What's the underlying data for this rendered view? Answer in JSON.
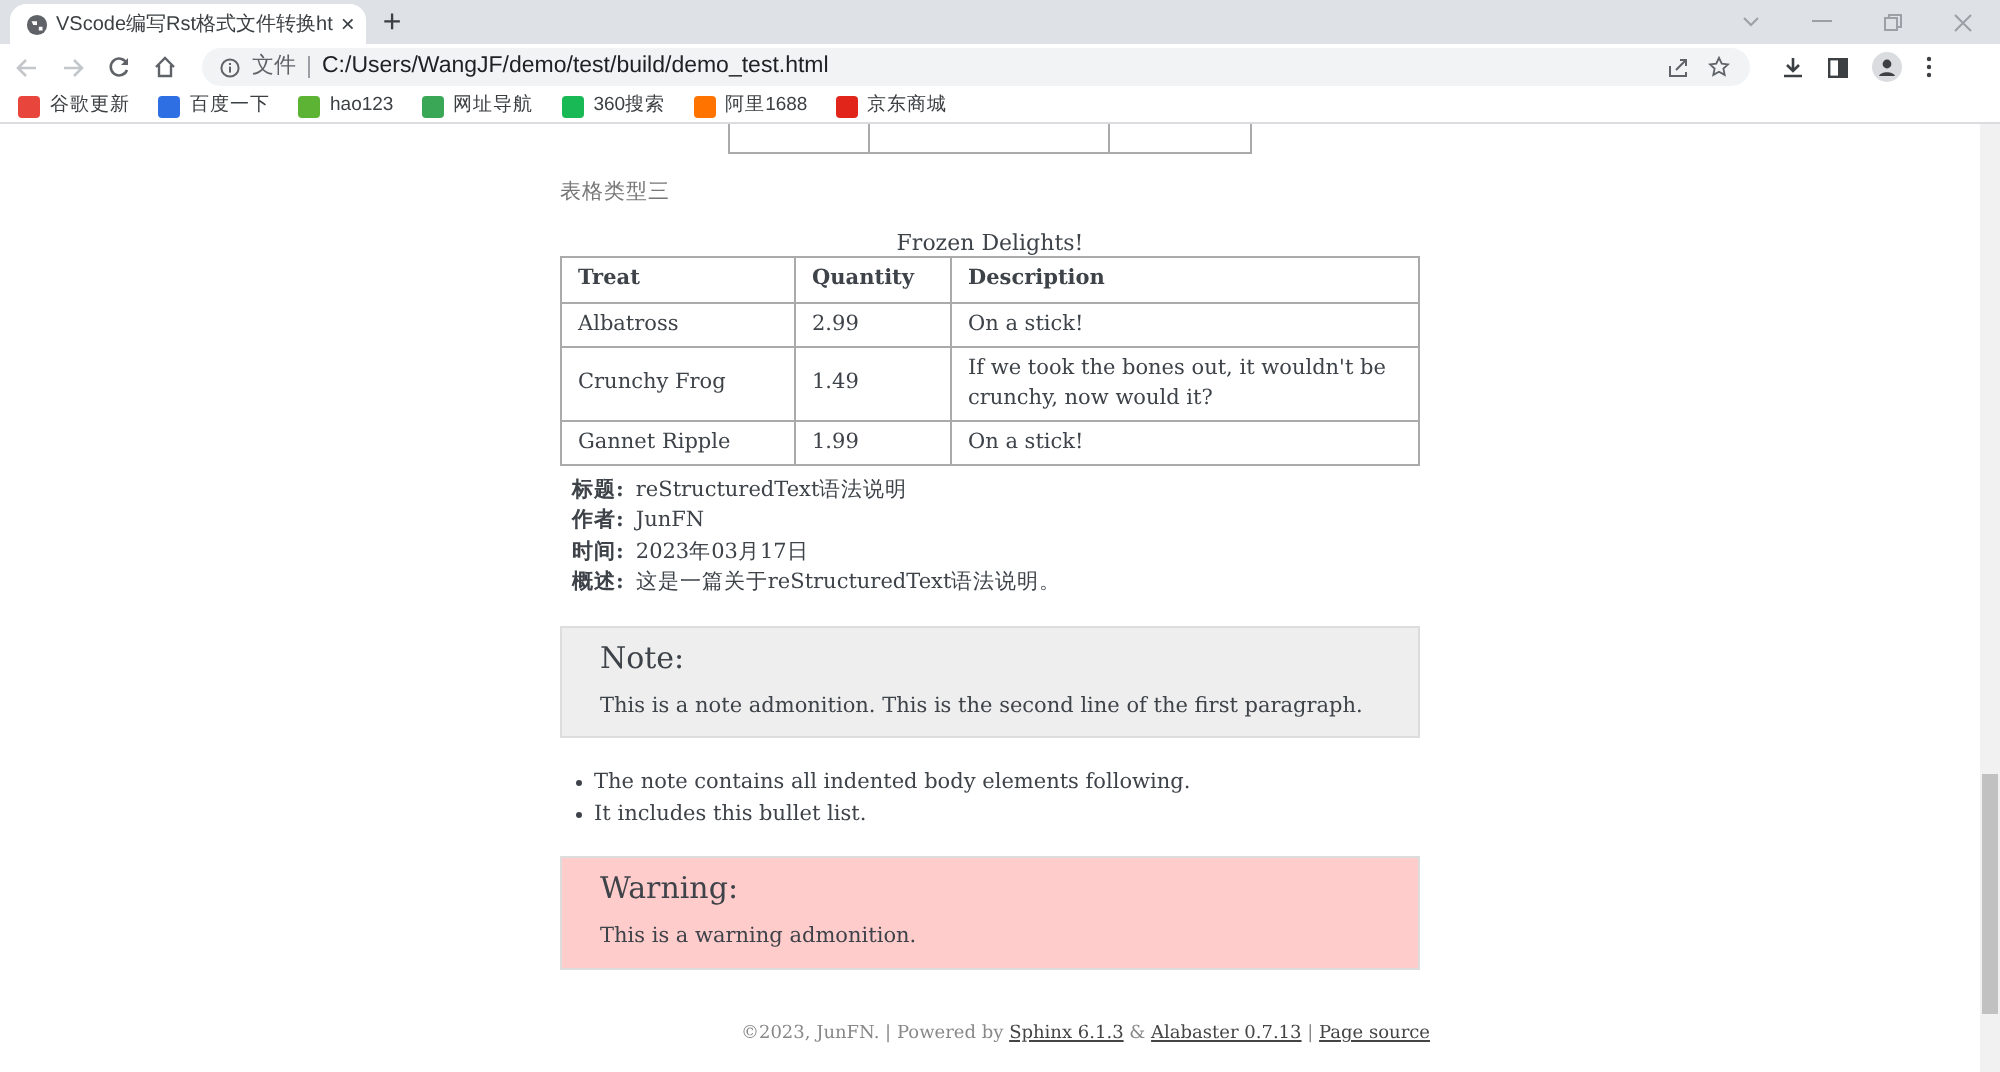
{
  "browser": {
    "tab": {
      "title": "VScode编写Rst格式文件转换ht",
      "close": "×"
    },
    "new_tab": "+",
    "address": {
      "scheme": "文件",
      "url": "C:/Users/WangJF/demo/test/build/demo_test.html"
    },
    "bookmarks": [
      {
        "label": "谷歌更新",
        "color": "#e8453c"
      },
      {
        "label": "百度一下",
        "color": "#2f6fe4"
      },
      {
        "label": "hao123",
        "color": "#5db333"
      },
      {
        "label": "网址导航",
        "color": "#3aa757"
      },
      {
        "label": "360搜索",
        "color": "#19b955"
      },
      {
        "label": "阿里1688",
        "color": "#ff7300"
      },
      {
        "label": "京东商城",
        "color": "#e1251b"
      }
    ]
  },
  "page": {
    "section_title": "表格类型三",
    "table": {
      "caption": "Frozen Delights!",
      "columns": [
        "Treat",
        "Quantity",
        "Description"
      ],
      "rows": [
        [
          "Albatross",
          "2.99",
          "On a stick!"
        ],
        [
          "Crunchy Frog",
          "1.49",
          "If we took the bones out, it wouldn't be crunchy, now would it?"
        ],
        [
          "Gannet Ripple",
          "1.99",
          "On a stick!"
        ]
      ]
    },
    "fields": [
      {
        "label": "标题:",
        "value": "reStructuredText语法说明"
      },
      {
        "label": "作者:",
        "value": "JunFN"
      },
      {
        "label": "时间:",
        "value": "2023年03月17日"
      },
      {
        "label": "概述:",
        "value": "这是一篇关于reStructuredText语法说明。"
      }
    ],
    "note": {
      "kind": "note",
      "title": "Note:",
      "body": "This is a note admonition. This is the second line of the first paragraph."
    },
    "bullets": [
      "The note contains all indented body elements following.",
      "It includes this bullet list."
    ],
    "warning": {
      "kind": "warning",
      "title": "Warning:",
      "body": "This is a warning admonition."
    },
    "footer": [
      {
        "kind": "text",
        "text": "©2023, JunFN. | Powered by "
      },
      {
        "kind": "link",
        "text": "Sphinx 6.1.3"
      },
      {
        "kind": "text",
        "text": " & "
      },
      {
        "kind": "link",
        "text": "Alabaster 0.7.13"
      },
      {
        "kind": "text",
        "text": " | "
      },
      {
        "kind": "link",
        "text": "Page source"
      }
    ]
  }
}
